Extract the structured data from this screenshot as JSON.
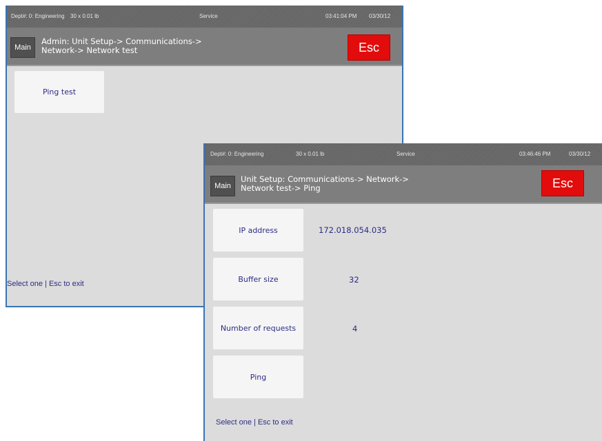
{
  "back_window": {
    "status": {
      "dept": "Dept#: 0: Engineering",
      "capacity": "30 x 0.01 lb",
      "mode": "Service",
      "time": "03:41:04 PM",
      "date": "03/30/12"
    },
    "header": {
      "main_label": "Main",
      "breadcrumb_line1": "Admin: Unit Setup-> Communications->",
      "breadcrumb_line2": "Network-> Network test",
      "esc_label": "Esc"
    },
    "buttons": [
      {
        "label": "Ping test"
      }
    ],
    "footer_hint": "Select one | Esc to exit"
  },
  "front_window": {
    "status": {
      "dept": "Dept#: 0: Engineering",
      "capacity": "30 x 0.01 lb",
      "mode": "Service",
      "time": "03:46:46 PM",
      "date": "03/30/12"
    },
    "header": {
      "main_label": "Main",
      "breadcrumb_line1": "Unit Setup: Communications-> Network->",
      "breadcrumb_line2": "Network test-> Ping",
      "esc_label": "Esc"
    },
    "fields": [
      {
        "label": "IP address",
        "value": "172.018.054.035"
      },
      {
        "label": "Buffer size",
        "value": "32"
      },
      {
        "label": "Number of requests",
        "value": "4"
      },
      {
        "label": "Ping",
        "value": ""
      }
    ],
    "footer_hint": "Select one | Esc to exit"
  },
  "colors": {
    "esc_red": "#e20c0c",
    "text_navy": "#2c2c85",
    "panel_gray": "#dcdcdc",
    "window_border_blue": "#3a72b4"
  }
}
